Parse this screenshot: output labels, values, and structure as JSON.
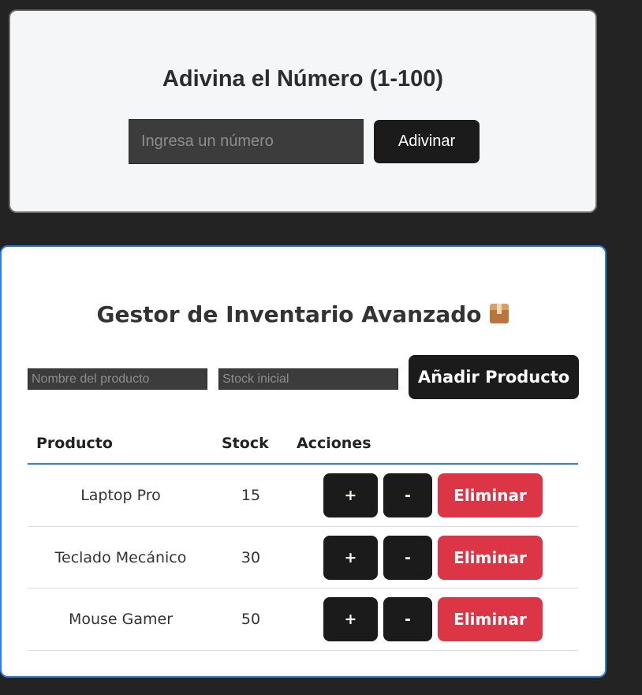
{
  "guess_game": {
    "title": "Adivina el Número (1-100)",
    "input_placeholder": "Ingresa un número",
    "input_value": "",
    "button_label": "Adivinar"
  },
  "inventory": {
    "title": "Gestor de Inventario Avanzado",
    "title_icon": "package-icon",
    "name_placeholder": "Nombre del producto",
    "stock_placeholder": "Stock inicial",
    "add_button_label": "Añadir Producto",
    "headers": {
      "product": "Producto",
      "stock": "Stock",
      "actions": "Acciones"
    },
    "rows": [
      {
        "name": "Laptop Pro",
        "stock": "15",
        "inc": "+",
        "dec": "-",
        "delete": "Eliminar"
      },
      {
        "name": "Teclado Mecánico",
        "stock": "30",
        "inc": "+",
        "dec": "-",
        "delete": "Eliminar"
      },
      {
        "name": "Mouse Gamer",
        "stock": "50",
        "inc": "+",
        "dec": "-",
        "delete": "Eliminar"
      }
    ]
  },
  "colors": {
    "page_background": "#232323",
    "accent_border": "#2f7fe0",
    "danger": "#dc3545",
    "dark_button": "#1b1b1b"
  }
}
